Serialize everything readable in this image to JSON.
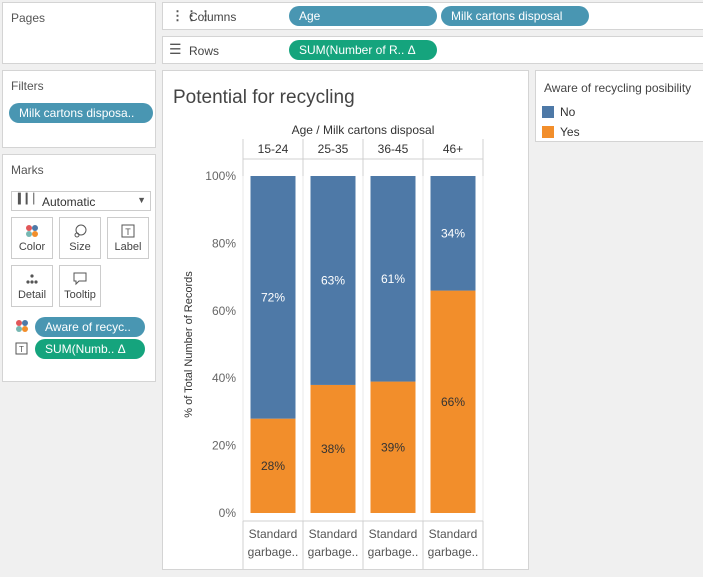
{
  "pages": {
    "title": "Pages"
  },
  "columns": {
    "label": "Columns",
    "pills": [
      "Age",
      "Milk cartons disposal"
    ]
  },
  "rows": {
    "label": "Rows",
    "pill": "SUM(Number of R.. Δ"
  },
  "filters": {
    "title": "Filters",
    "pill": "Milk cartons disposa.."
  },
  "marks": {
    "title": "Marks",
    "type": "Automatic",
    "buttons": {
      "color": "Color",
      "size": "Size",
      "label": "Label",
      "detail": "Detail",
      "tooltip": "Tooltip"
    },
    "fields": [
      "Aware of recyc..",
      "SUM(Numb.. Δ"
    ]
  },
  "legend": {
    "title": "Aware of recycling posibility",
    "items": [
      {
        "label": "No",
        "color": "#4e79a7"
      },
      {
        "label": "Yes",
        "color": "#f28e2b"
      }
    ]
  },
  "icons": {
    "columns": "columns-icon",
    "rows": "rows-icon",
    "marks_type": "bar-chart-icon",
    "color": "color-dots-icon",
    "size": "size-icon",
    "label": "label-T-icon",
    "detail": "detail-dots-icon",
    "tooltip": "tooltip-bubble-icon",
    "dropdown": "chevron-down-icon"
  },
  "chart_data": {
    "type": "bar",
    "stacked": true,
    "title": "Potential for recycling",
    "header_title": "Age / Milk cartons disposal",
    "ylabel": "% of Total Number of Records",
    "ylim": [
      0,
      100
    ],
    "yticks": [
      "0%",
      "20%",
      "40%",
      "60%",
      "80%",
      "100%"
    ],
    "categories": [
      "15-24",
      "25-35",
      "36-45",
      "46+"
    ],
    "subcategories": [
      "Standard garbage..",
      "Standard garbage..",
      "Standard garbage..",
      "Standard garbage.."
    ],
    "series": [
      {
        "name": "Yes",
        "color": "#f28e2b",
        "values": [
          28,
          38,
          39,
          66
        ],
        "labels": [
          "28%",
          "38%",
          "39%",
          "66%"
        ]
      },
      {
        "name": "No",
        "color": "#4e79a7",
        "values": [
          72,
          63,
          61,
          34
        ],
        "labels": [
          "72%",
          "63%",
          "61%",
          "34%"
        ]
      }
    ]
  }
}
